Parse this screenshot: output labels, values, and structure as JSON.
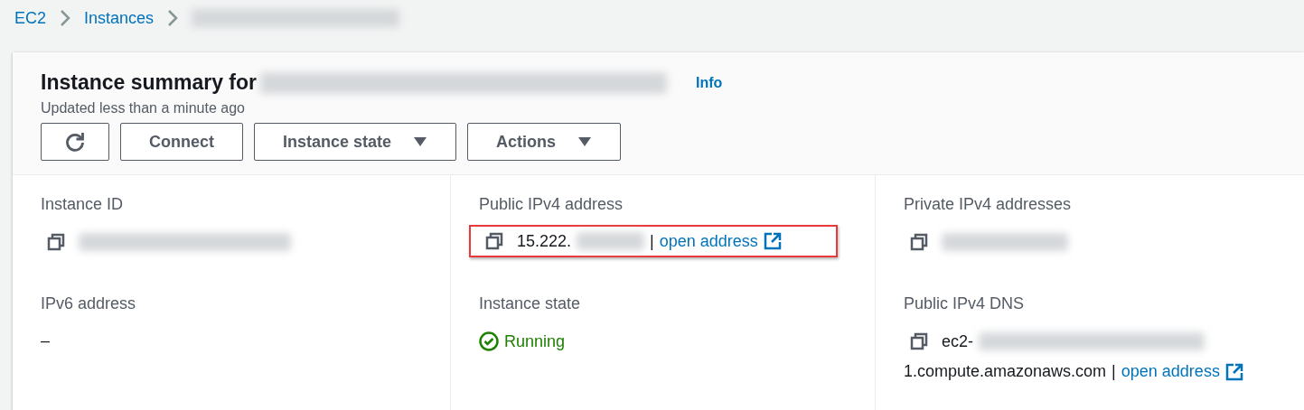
{
  "breadcrumb": [
    {
      "kind": "link",
      "label": "EC2"
    },
    {
      "kind": "link",
      "label": "Instances"
    },
    {
      "kind": "redacted"
    }
  ],
  "header": {
    "title": [
      {
        "kind": "text",
        "text": "Instance summary for"
      },
      {
        "kind": "redacted"
      }
    ],
    "info_link": "Info",
    "subtitle": "Updated less than a minute ago",
    "buttons": [
      {
        "kind": "refresh"
      },
      {
        "kind": "text",
        "label": "Connect"
      },
      {
        "kind": "dropdown",
        "label": "Instance state"
      },
      {
        "kind": "dropdown",
        "label": "Actions"
      }
    ]
  },
  "columns": [
    [
      {
        "label": "Instance ID",
        "highlighted": false,
        "parts": [
          {
            "kind": "copy"
          },
          {
            "kind": "redacted"
          }
        ]
      },
      {
        "label": "IPv6 address",
        "highlighted": false,
        "parts": [
          {
            "kind": "text",
            "text": "–"
          }
        ]
      }
    ],
    [
      {
        "label": "Public IPv4 address",
        "highlighted": true,
        "parts": [
          {
            "kind": "copy"
          },
          {
            "kind": "text",
            "text": "15.222."
          },
          {
            "kind": "redacted"
          },
          {
            "kind": "sep",
            "text": "|"
          },
          {
            "kind": "link",
            "text": "open address"
          }
        ]
      },
      {
        "label": "Instance state",
        "highlighted": false,
        "parts": [
          {
            "kind": "ok",
            "text": "Running"
          }
        ]
      }
    ],
    [
      {
        "label": "Private IPv4 addresses",
        "highlighted": false,
        "parts": [
          {
            "kind": "copy"
          },
          {
            "kind": "redacted"
          }
        ]
      },
      {
        "label": "Public IPv4 DNS",
        "highlighted": false,
        "parts": [
          {
            "kind": "copy"
          },
          {
            "kind": "text",
            "text": "ec2-"
          },
          {
            "kind": "redacted"
          },
          {
            "kind": "break"
          },
          {
            "kind": "text",
            "text": "1.compute.amazonaws.com"
          },
          {
            "kind": "sep",
            "text": "|"
          },
          {
            "kind": "link",
            "text": "open address"
          }
        ]
      }
    ]
  ]
}
